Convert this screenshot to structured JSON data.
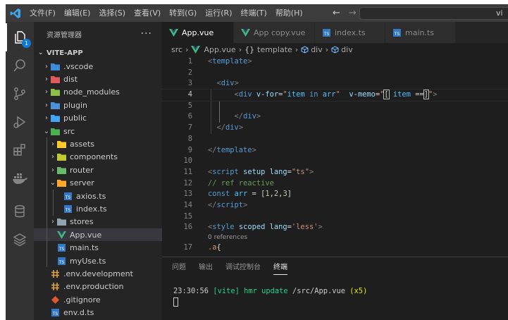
{
  "menu": [
    "文件(F)",
    "编辑(E)",
    "选择(S)",
    "查看(V)",
    "转到(G)",
    "运行(R)",
    "终端(T)",
    "帮助(H)"
  ],
  "title_fragment": "vi",
  "explorer": {
    "title": "资源管理器",
    "more": "···",
    "project": "VITE-APP",
    "items": [
      {
        "label": ".vscode",
        "depth": 0,
        "chev": "›",
        "icon": "folder-vscode-icon",
        "color": "#3c8ad8"
      },
      {
        "label": "dist",
        "depth": 0,
        "chev": "›",
        "icon": "folder-dist-icon",
        "color": "#e05c5c"
      },
      {
        "label": "node_modules",
        "depth": 0,
        "chev": "›",
        "icon": "folder-node-icon",
        "color": "#8bc34a"
      },
      {
        "label": "plugin",
        "depth": 0,
        "chev": "›",
        "icon": "folder-plugin-icon",
        "color": "#4a90d9"
      },
      {
        "label": "public",
        "depth": 0,
        "chev": "›",
        "icon": "folder-public-icon",
        "color": "#42a5f5"
      },
      {
        "label": "src",
        "depth": 0,
        "chev": "⌄",
        "icon": "folder-src-icon",
        "color": "#4caf50"
      },
      {
        "label": "assets",
        "depth": 1,
        "chev": "›",
        "icon": "folder-assets-icon",
        "color": "#ffca28"
      },
      {
        "label": "components",
        "depth": 1,
        "chev": "›",
        "icon": "folder-components-icon",
        "color": "#c0ca33"
      },
      {
        "label": "router",
        "depth": 1,
        "chev": "›",
        "icon": "folder-router-icon",
        "color": "#66bb6a"
      },
      {
        "label": "server",
        "depth": 1,
        "chev": "⌄",
        "icon": "folder-server-icon",
        "color": "#ffa726"
      },
      {
        "label": "axios.ts",
        "depth": 2,
        "chev": "",
        "icon": "typescript-file-icon",
        "color": "#3178c6"
      },
      {
        "label": "index.ts",
        "depth": 2,
        "chev": "",
        "icon": "typescript-file-icon",
        "color": "#3178c6"
      },
      {
        "label": "stores",
        "depth": 1,
        "chev": "›",
        "icon": "folder-stores-icon",
        "color": "#90a4ae"
      },
      {
        "label": "App.vue",
        "depth": 1,
        "chev": "",
        "icon": "vue-file-icon",
        "color": "#41b883",
        "selected": true
      },
      {
        "label": "main.ts",
        "depth": 1,
        "chev": "",
        "icon": "typescript-file-icon",
        "color": "#3178c6"
      },
      {
        "label": "myUse.ts",
        "depth": 1,
        "chev": "",
        "icon": "typescript-file-icon",
        "color": "#3178c6"
      },
      {
        "label": ".env.development",
        "depth": 0,
        "chev": "",
        "icon": "env-file-icon",
        "color": "#e0a04a"
      },
      {
        "label": ".env.production",
        "depth": 0,
        "chev": "",
        "icon": "env-file-icon",
        "color": "#e0a04a"
      },
      {
        "label": ".gitignore",
        "depth": 0,
        "chev": "",
        "icon": "git-file-icon",
        "color": "#e4572e"
      },
      {
        "label": "env.d.ts",
        "depth": 0,
        "chev": "",
        "icon": "typescript-file-icon",
        "color": "#3178c6"
      }
    ]
  },
  "tabs": [
    {
      "label": "App.vue",
      "icon": "vue-file-icon",
      "active": true,
      "dirty": true
    },
    {
      "label": "App copy.vue",
      "icon": "vue-file-icon",
      "active": false
    },
    {
      "label": "index.ts",
      "icon": "typescript-file-icon",
      "active": false
    },
    {
      "label": "main.ts",
      "icon": "typescript-file-icon",
      "active": false
    }
  ],
  "breadcrumb": [
    "src",
    "App.vue",
    "template",
    "div",
    "div"
  ],
  "code_lines": [
    {
      "n": "1",
      "html": "<span class='punct'>&lt;</span><span class='tag'>template</span><span class='punct'>&gt;</span>"
    },
    {
      "n": "2",
      "html": ""
    },
    {
      "n": "3",
      "html": "  <span class='punct'>&lt;</span><span class='tag'>div</span><span class='punct'>&gt;</span>"
    },
    {
      "n": "4",
      "current": true,
      "html": "      <span class='punct'>&lt;</span><span class='tag'>div</span> <span class='attr'>v-for</span><span class='plain'>=</span><span class='str'>\"</span><span class='var'>item</span> <span class='kw'>in</span> <span class='var'>arr</span><span class='str'>\"</span>  <span class='attr'>v-memo</span><span class='plain'>=</span><span class='str'>\"</span><span class='plain bracket-box'>[</span> <span class='var'>item</span> <span class='plain'>==</span><span class='plain bracket-box'>]</span><span class='str'>\"</span><span class='punct'>&gt;</span>"
    },
    {
      "n": "5",
      "html": ""
    },
    {
      "n": "6",
      "html": "      <span class='punct'>&lt;/</span><span class='tag'>div</span><span class='punct'>&gt;</span>"
    },
    {
      "n": "7",
      "html": "  <span class='punct'>&lt;/</span><span class='tag'>div</span><span class='punct'>&gt;</span>"
    },
    {
      "n": "8",
      "html": ""
    },
    {
      "n": "9",
      "html": "<span class='punct'>&lt;/</span><span class='tag'>template</span><span class='punct'>&gt;</span>"
    },
    {
      "n": "10",
      "html": ""
    },
    {
      "n": "11",
      "html": "<span class='punct'>&lt;</span><span class='tag'>script</span> <span class='attr'>setup</span> <span class='attr'>lang</span><span class='plain'>=</span><span class='str'>\"ts\"</span><span class='punct'>&gt;</span>"
    },
    {
      "n": "12",
      "html": "<span class='cmt'>// ref reactive</span>"
    },
    {
      "n": "13",
      "html": "<span class='kw'>const</span> <span class='var'>arr</span> <span class='plain'>= [</span><span class='num'>1</span><span class='plain'>,</span><span class='num'>2</span><span class='plain'>,</span><span class='num'>3</span><span class='plain'>]</span>"
    },
    {
      "n": "14",
      "html": "<span class='punct'>&lt;/</span><span class='tag'>script</span><span class='punct'>&gt;</span>"
    },
    {
      "n": "15",
      "html": ""
    },
    {
      "n": "16",
      "html": "<span class='punct'>&lt;</span><span class='tag'>style</span> <span class='attr'>scoped</span> <span class='attr'>lang</span><span class='plain'>=</span><span class='str'>'less'</span><span class='punct'>&gt;</span>"
    },
    {
      "n": "",
      "lens": true,
      "html": "0 references"
    },
    {
      "n": "17",
      "html": "<span class='str'>.a</span><span class='plain'>{</span>"
    }
  ],
  "panel": {
    "tabs": [
      "问题",
      "输出",
      "调试控制台",
      "终端"
    ],
    "active_tab": "终端"
  },
  "terminal": {
    "time": "23:30:56",
    "tag": "[vite]",
    "message": "hmr update",
    "path": "/src/App.vue",
    "count": "(x5)"
  }
}
